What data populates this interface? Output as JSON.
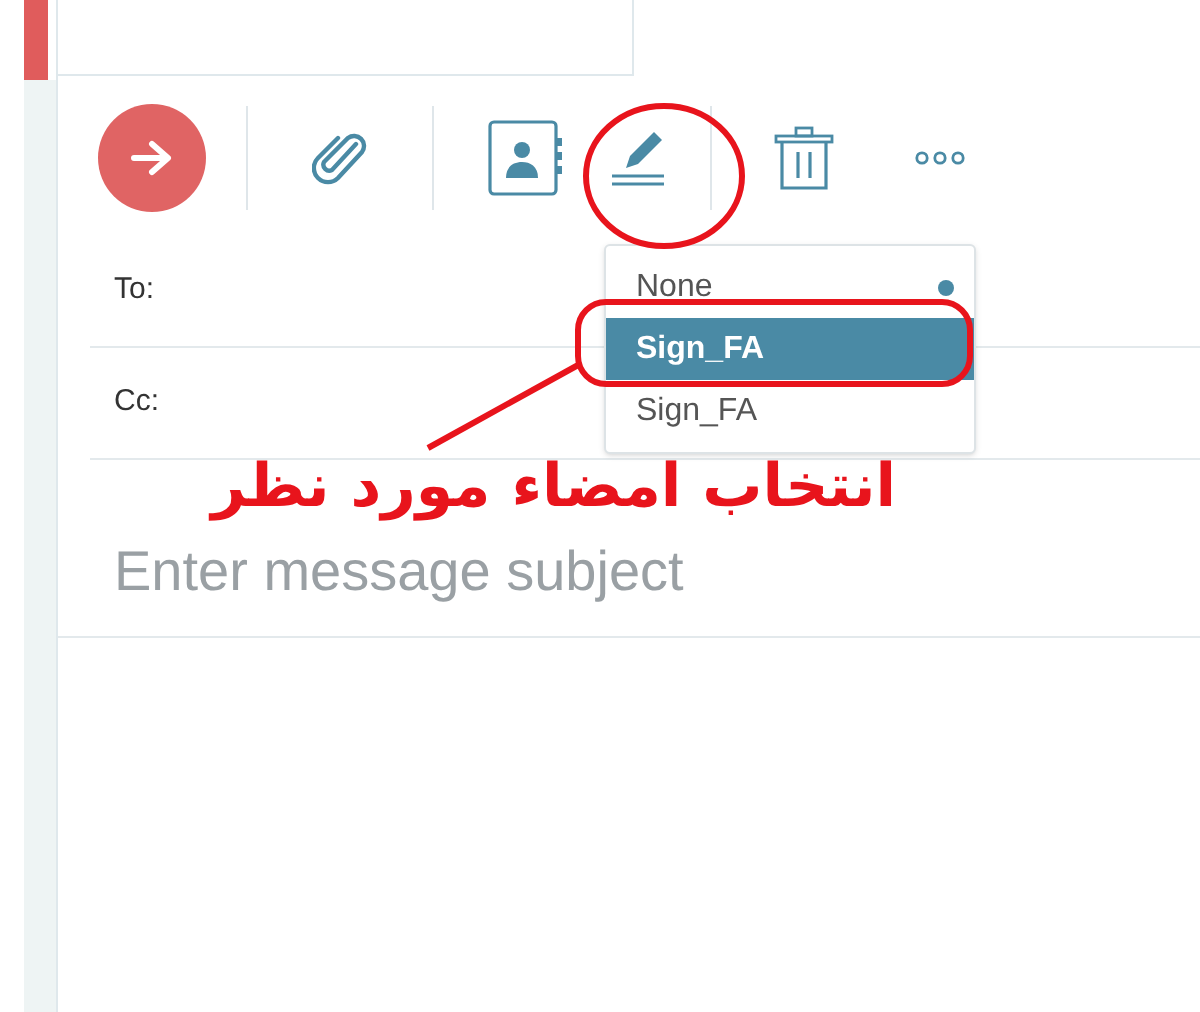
{
  "toolbar": {
    "buttons": [
      {
        "kind": "send"
      },
      {
        "kind": "attach"
      },
      {
        "kind": "contacts"
      },
      {
        "kind": "signature",
        "selected": true
      },
      {
        "kind": "delete"
      },
      {
        "kind": "more"
      }
    ]
  },
  "signature_menu": {
    "items": [
      {
        "label": "None",
        "selected": false,
        "current": true
      },
      {
        "label": "Sign_FA",
        "selected": true,
        "current": false
      },
      {
        "label": "Sign_FA",
        "selected": false,
        "current": false
      }
    ]
  },
  "fields": [
    {
      "label": "To:"
    },
    {
      "label": "Cc:"
    }
  ],
  "subject": {
    "placeholder": "Enter message subject"
  },
  "annotation": {
    "text": "انتخاب امضاء مورد نظر"
  }
}
